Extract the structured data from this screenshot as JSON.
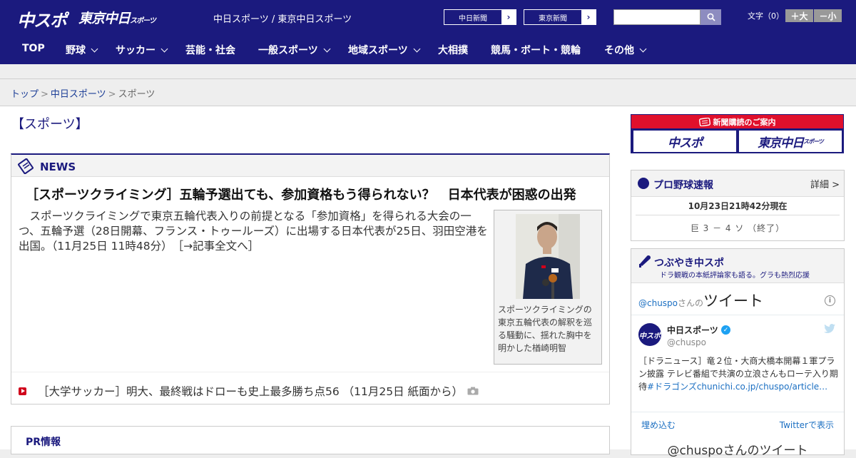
{
  "header": {
    "logo_chuspo": "中スポ",
    "logo_tokyo": "東京中日",
    "logo_tokyo_small": "スポーツ",
    "site_name": "中日スポーツ / 東京中日スポーツ",
    "paper_buttons": [
      "中日新聞",
      "東京新聞"
    ],
    "search": {
      "placeholder": ""
    },
    "font_size_label": "文字（0）",
    "font_larger": "＋大",
    "font_smaller": "－小",
    "colors": {
      "brand": "#1b1a7e",
      "accent_red": "#e0102c"
    }
  },
  "nav": {
    "items": [
      {
        "label": "TOP"
      },
      {
        "label": "野球"
      },
      {
        "label": "サッカー"
      },
      {
        "label": "芸能・社会"
      },
      {
        "label": "一般スポーツ"
      },
      {
        "label": "地域スポーツ"
      },
      {
        "label": "大相撲"
      },
      {
        "label": "競馬・ボート・競輪"
      },
      {
        "label": "その他"
      }
    ]
  },
  "breadcrumb": {
    "items": [
      "トップ",
      "中日スポーツ",
      "スポーツ"
    ],
    "separator": ">"
  },
  "page_title": "【スポーツ】",
  "news": {
    "section_title": "NEWS",
    "headline": "［スポーツクライミング］五輪予選出ても、参加資格もう得られない？　日本代表が困惑の出発",
    "lead": "スポーツクライミングで東京五輪代表入りの前提となる「参加資格」を得られる大会の一つ、五輪予選（28日開幕、フランス・トゥールーズ）に出場する日本代表が25日、羽田空港を出国。（11月25日 11時48分）",
    "read_more": "［→記事全文へ］",
    "photo_caption": "スポーツクライミングの東京五輪代表の解釈を巡る騒動に、揺れた胸中を明かした楢崎明智",
    "sub_items": [
      {
        "text": "［大学サッカー］明大、最終戦はドローも史上最多勝ち点56 （11月25日 紙面から）",
        "icon": "camera-icon"
      }
    ]
  },
  "pr": {
    "title": "PR情報"
  },
  "sidebar": {
    "subscription": {
      "title": "新聞購読のご案内",
      "logos": [
        "中スポ",
        "東京中日"
      ],
      "logo_small": "スポーツ"
    },
    "baseball": {
      "title": "プロ野球速報",
      "more": "詳細 >",
      "time": "10月23日21時42分現在",
      "score": "巨 3 － 4 ソ （終了）"
    },
    "tweets": {
      "title": "つぶやき中スポ",
      "subtitle": "ドラ観戦の本紙評論家も語る。グラも熱烈応援",
      "embed_handle": "@chuspo",
      "embed_san": "さんの",
      "embed_tweet": "ツイート",
      "account_name": "中日スポーツ",
      "account_handle": "@chuspo",
      "avatar_text": "中スポ",
      "tweet_text": "［ドラニュース］竜２位・大商大橋本開幕１軍プラン披露 テレビ番組で共演の立浪さんもローテ入り期待",
      "tweet_tag": "#ドラゴンズchunichi.co.jp/chuspo/article…",
      "embed_label": "埋め込む",
      "view_on_twitter": "Twitterで表示",
      "footer": "@chuspoさんのツイート"
    }
  }
}
